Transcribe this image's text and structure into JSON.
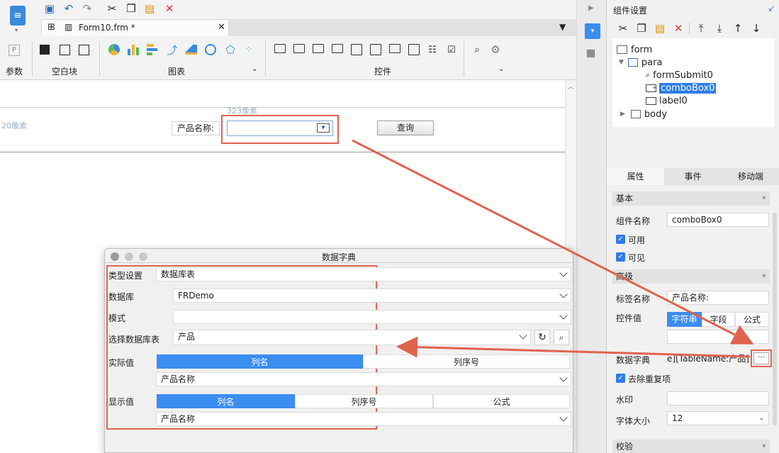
{
  "toolbar": {
    "tab_title": "Form10.frm *",
    "groups": [
      "参数",
      "空白块",
      "图表",
      "控件"
    ],
    "param_icon_text": "P"
  },
  "canvas": {
    "width_hint": "323像素",
    "offset_hint": "20像素",
    "product_label": "产品名称:",
    "query_button": "查询"
  },
  "component_panel": {
    "title": "组件设置",
    "tree": [
      "form",
      "para",
      "formSubmit0",
      "comboBox0",
      "label0",
      "body"
    ],
    "tabs": [
      "属性",
      "事件",
      "移动端"
    ],
    "sections": {
      "basic": "基本",
      "advanced": "高级",
      "validate": "校验"
    },
    "component_name_label": "组件名称",
    "component_name_value": "comboBox0",
    "enabled_label": "可用",
    "visible_label": "可见",
    "tag_name_label": "标签名称",
    "tag_name_value": "产品名称:",
    "widget_value_label": "控件值",
    "value_types": [
      "字符串",
      "字段",
      "公式"
    ],
    "data_dict_label": "数据字典",
    "data_dict_value": "e][TableName:产品]",
    "ellipsis": "···",
    "dedupe_label": "去除重复项",
    "watermark_label": "水印",
    "font_size_label": "字体大小",
    "font_size_value": "12"
  },
  "dialog": {
    "title": "数据字典",
    "type_label": "类型设置",
    "type_value": "数据库表",
    "db_label": "数据库",
    "db_value": "FRDemo",
    "mode_label": "模式",
    "mode_value": "",
    "table_label": "选择数据库表",
    "table_value": "产品",
    "actual_label": "实际值",
    "actual_tabs": [
      "列名",
      "列序号"
    ],
    "actual_value": "产品名称",
    "display_label": "显示值",
    "display_tabs": [
      "列名",
      "列序号",
      "公式"
    ],
    "display_value": "产品名称"
  },
  "colors": {
    "accent": "#3b8df0",
    "highlight": "#e0634e",
    "selected_tree": "#2d7de6"
  }
}
